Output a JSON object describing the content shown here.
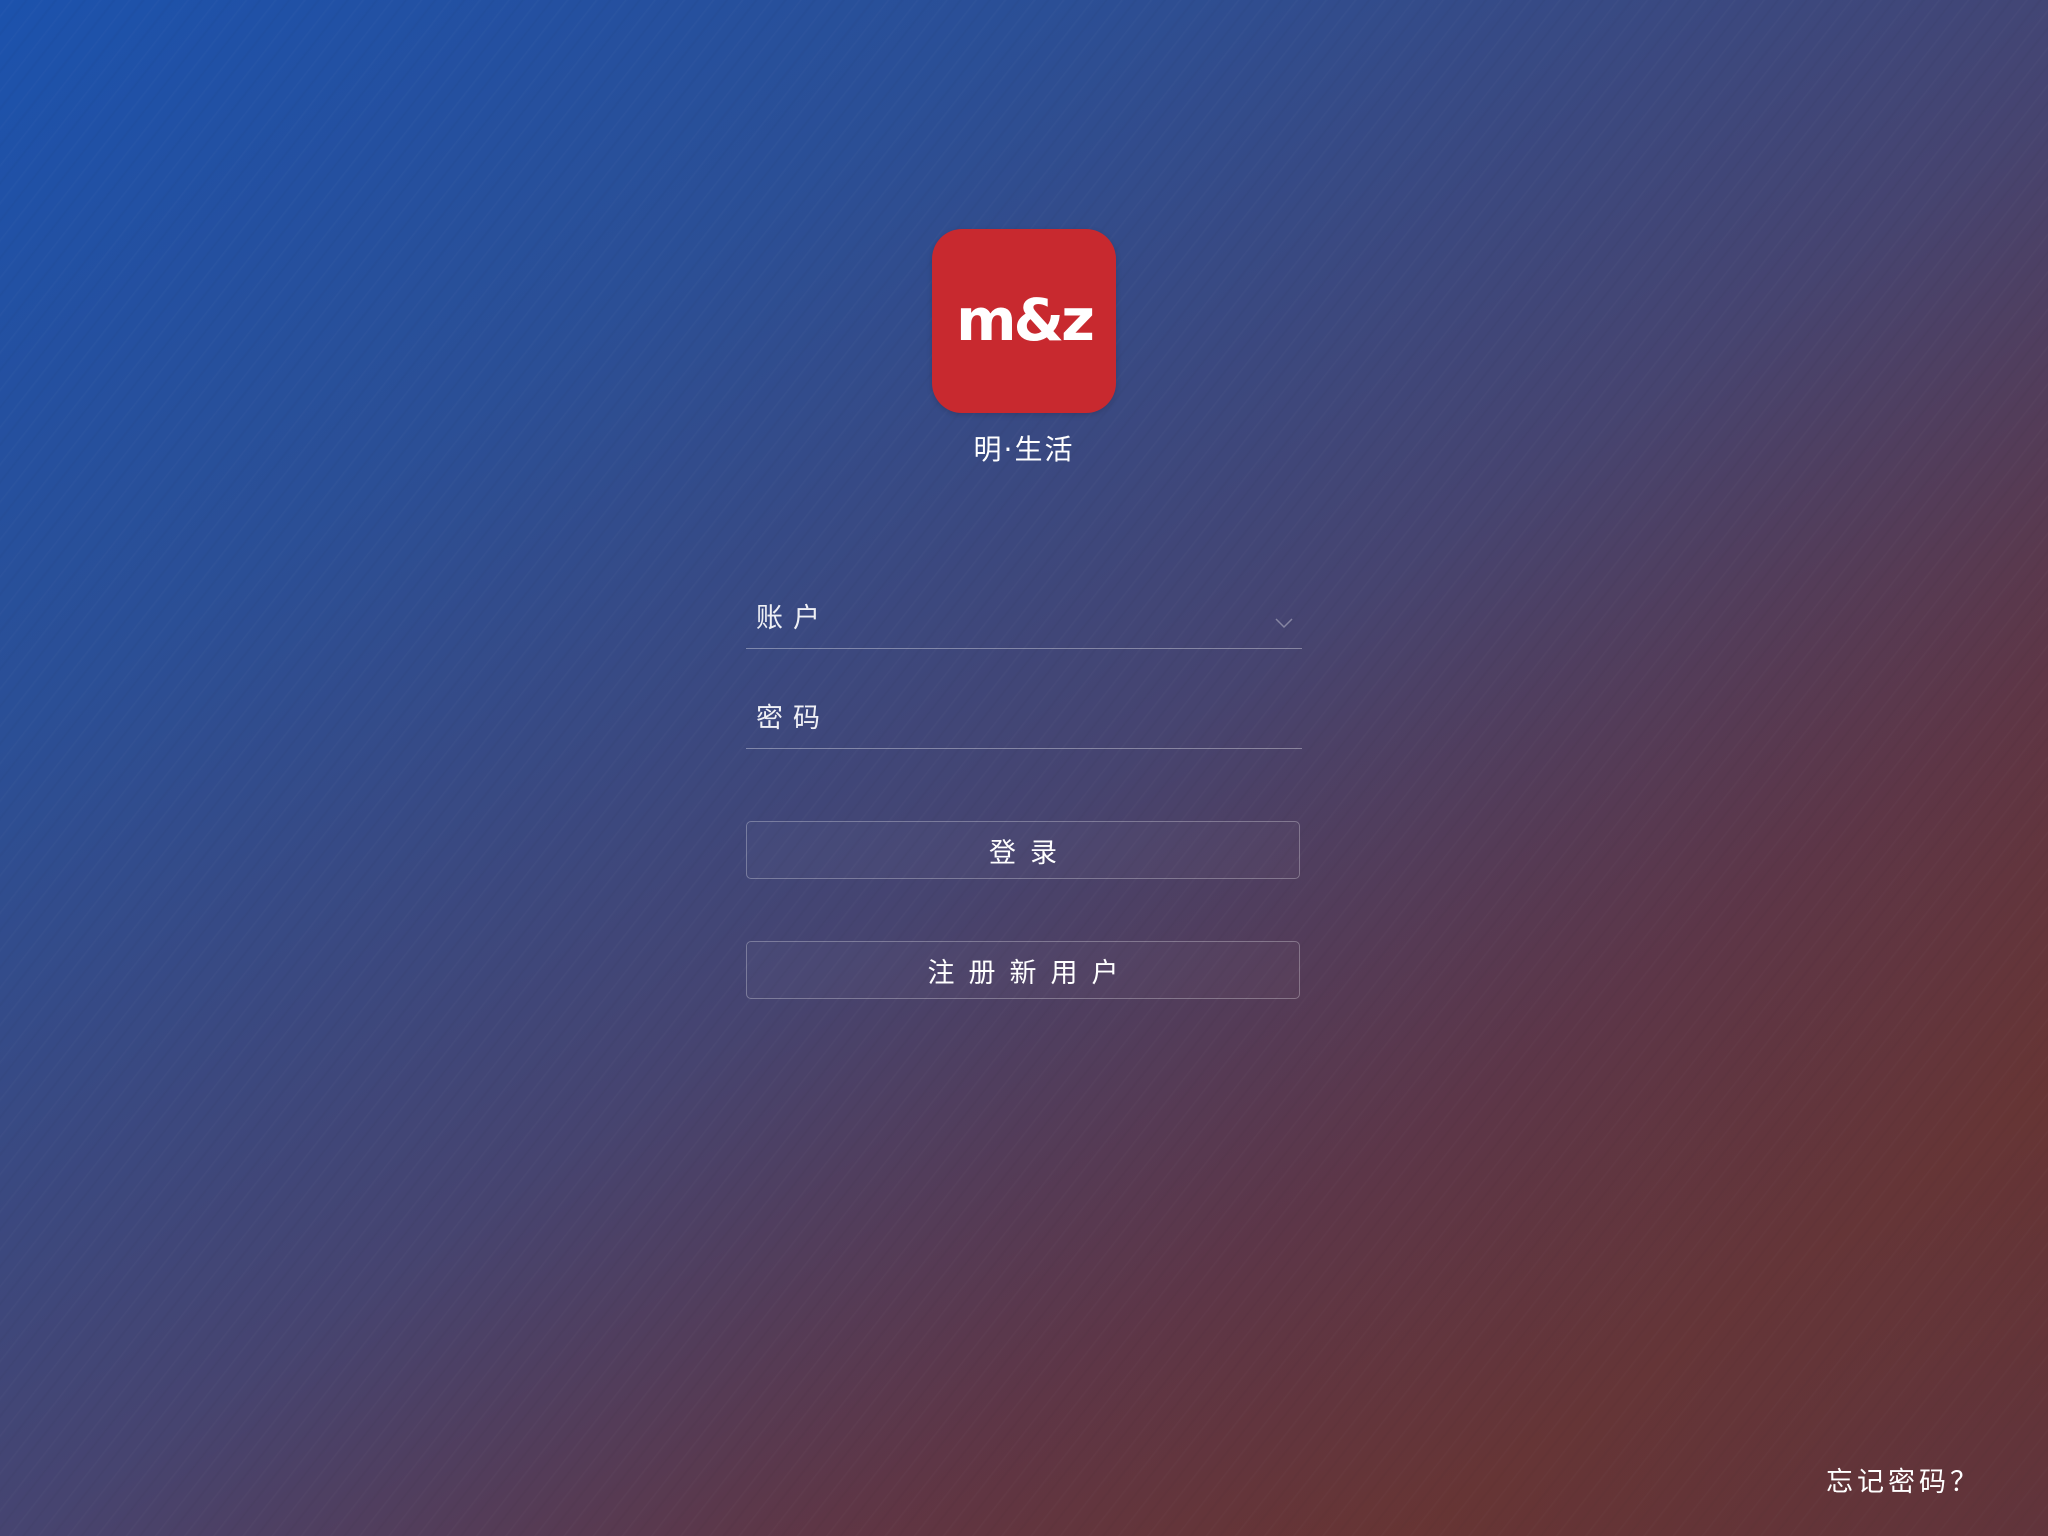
{
  "app": {
    "logo_text": "m&z",
    "name": "明·生活",
    "brand_color": "#c8292f"
  },
  "form": {
    "account_placeholder": "账户",
    "account_icon": "chevron-down-icon",
    "password_placeholder": "密码"
  },
  "actions": {
    "login_label": "登录",
    "register_label": "注册新用户",
    "forgot_label": "忘记密码？"
  }
}
